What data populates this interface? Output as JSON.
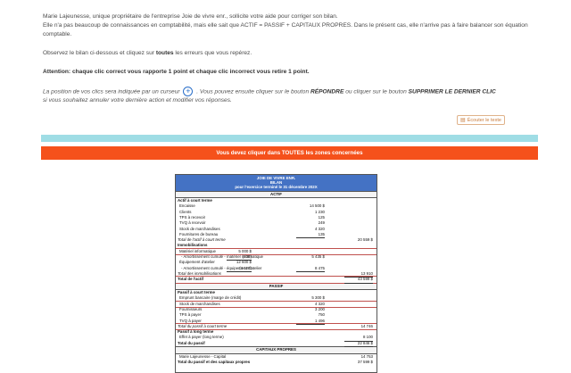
{
  "intro": {
    "p1_line1": "Marie Lajeunesse, unique propriétaire de l'entreprise Joie de vivre enr., sollicite votre aide pour corriger son bilan.",
    "p1_line2": "Elle n'a pas beaucoup de connaissances en comptabilité, mais elle sait que ACTIF = PASSIF + CAPITAUX PROPRES. Dans le présent cas, elle n'arrive pas à faire balancer son équation comptable.",
    "p2_before": "Observez le bilan ci-dessous et cliquez sur ",
    "p2_bold": "toutes",
    "p2_after": " les erreurs que vous repérez.",
    "warning": "Attention: chaque clic correct vous rapporte 1 point et chaque clic incorrect vous retire 1 point.",
    "hint_part1": "La position de vos clics sera indiquée par un curseur",
    "hint_part2": ". Vous pouvez ensuite cliquer sur le bouton",
    "hint_btn1": "RÉPONDRE",
    "hint_part3": "ou cliquer sur le bouton",
    "hint_btn2": "SUPPRIMER LE DERNIER CLIC",
    "hint_part4": "si vous souhaitez annuler votre dernière action et modifier vos réponses."
  },
  "listen_button": {
    "icon": "speaker-icon",
    "label": "Écouter le texte"
  },
  "banner": {
    "text": "Vous devez cliquer dans TOUTES les zones concernées"
  },
  "colors": {
    "banner": "#f5511b",
    "bar": "#9fdde5",
    "header": "#4472c4"
  },
  "bilan": {
    "company": "JOIE DE VIVRE ENR.",
    "doc": "BILAN",
    "period": "pour l'exercice terminé le 31 décembre 202X",
    "actif_title": "ACTIF",
    "actif_rows": [
      {
        "label": "Actif à court terme",
        "c1": "",
        "c2": "",
        "c3": "",
        "style": "bold"
      },
      {
        "label": "Encaisse",
        "c1": "",
        "c2": "14 500  $",
        "c3": "",
        "style": "ind"
      },
      {
        "label": "Clients",
        "c1": "",
        "c2": "1 230",
        "c3": "",
        "style": "ind"
      },
      {
        "label": "TPS à recevoir",
        "c1": "",
        "c2": "125",
        "c3": "",
        "style": "ind"
      },
      {
        "label": "TVQ à recevoir",
        "c1": "",
        "c2": "249",
        "c3": "",
        "style": "ind"
      },
      {
        "label": "Stock de marchandises",
        "c1": "",
        "c2": "4 320",
        "c3": "",
        "style": "ind"
      },
      {
        "label": "Fournitures de bureau",
        "c1": "",
        "c2": "135",
        "c3": "",
        "style": "ind",
        "ul": "c2"
      },
      {
        "label": "Total de l'actif à court terme",
        "c1": "",
        "c2": "",
        "c3": "20 559  $",
        "style": "ital"
      },
      {
        "label": "Immobilisations",
        "c1": "",
        "c2": "",
        "c3": "",
        "style": "bold"
      },
      {
        "label": "Matériel informatique",
        "c1": "5 000  $",
        "c2": "",
        "c3": "",
        "style": "ind",
        "boxed": true
      },
      {
        "label": "- Amortissement cumulé - matériel informatique",
        "c1": "(435)",
        "c2": "5 435  $",
        "c3": "",
        "style": "ind2",
        "ul": "c1"
      },
      {
        "label": "Équipement d'atelier",
        "c1": "12 600  $",
        "c2": "",
        "c3": "",
        "style": "ind"
      },
      {
        "label": "- Amortissement cumulé - équipement d'atelier",
        "c1": "(4 125)",
        "c2": "8 475",
        "c3": "",
        "style": "ind2",
        "ul": "c1c2"
      },
      {
        "label": "Total des immobilisations",
        "c1": "",
        "c2": "",
        "c3": "13 910",
        "style": "ital",
        "ul": "c3"
      },
      {
        "label": "Total de l'actif",
        "c1": "",
        "c2": "",
        "c3": "43 599  $",
        "style": "bold",
        "dul": "c3",
        "boxed": true
      }
    ],
    "passif_title": "PASSIF",
    "passif_rows": [
      {
        "label": "Passif à court terme",
        "c1": "",
        "c2": "",
        "c3": "",
        "style": "bold"
      },
      {
        "label": "Emprunt bancaire (marge de crédit)",
        "c1": "",
        "c2": "5 300  $",
        "c3": "",
        "style": "ind"
      },
      {
        "label": "Stock de marchandises",
        "c1": "",
        "c2": "4 320",
        "c3": "",
        "style": "ind",
        "boxed": true
      },
      {
        "label": "Fournisseurs",
        "c1": "",
        "c2": "3 200",
        "c3": "",
        "style": "ind"
      },
      {
        "label": "TPS à payer",
        "c1": "",
        "c2": "750",
        "c3": "",
        "style": "ind"
      },
      {
        "label": "TVQ à payer",
        "c1": "",
        "c2": "1 496",
        "c3": "",
        "style": "ind",
        "ul": "c2"
      },
      {
        "label": "Total du passif à court terme",
        "c1": "",
        "c2": "",
        "c3": "14 746",
        "style": "ital",
        "boxed": true
      },
      {
        "label": "Passif à long terme",
        "c1": "",
        "c2": "",
        "c3": "",
        "style": "bold"
      },
      {
        "label": "Effet à payer (long terme)",
        "c1": "",
        "c2": "",
        "c3": "8 100",
        "style": "ind",
        "ul": "c3"
      },
      {
        "label": "Total du passif",
        "c1": "",
        "c2": "",
        "c3": "22 846  $",
        "style": "bold",
        "dul": "c3"
      }
    ],
    "cp_title": "CAPITAUX PROPRES",
    "cp_rows": [
      {
        "label": "Marie Lajeunesse - Capital",
        "c1": "",
        "c2": "",
        "c3": "14 753",
        "style": "ind"
      },
      {
        "label": "Total du passif et des capitaux propres",
        "c1": "",
        "c2": "",
        "c3": "37 599  $",
        "style": "bold"
      }
    ]
  }
}
